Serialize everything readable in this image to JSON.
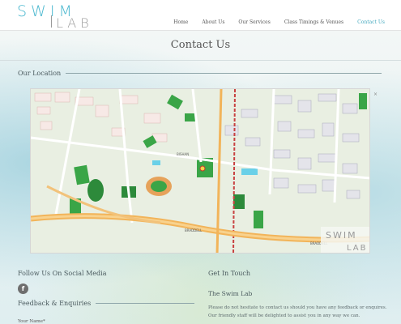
{
  "logo": {
    "line1": "SWIM",
    "line2": "LAB"
  },
  "nav": {
    "items": [
      {
        "label": "Home",
        "active": false
      },
      {
        "label": "About Us",
        "active": false
      },
      {
        "label": "Our Services",
        "active": false
      },
      {
        "label": "Class Timings & Venues",
        "active": false
      },
      {
        "label": "Contact Us",
        "active": true
      }
    ]
  },
  "page": {
    "title": "Contact Us"
  },
  "location": {
    "heading": "Our Location"
  },
  "map": {
    "watermark_line1": "SWIM",
    "watermark_line2": "LAB",
    "road_labels": [
      "BISHAN",
      "BRADDELL",
      "BRADDELL"
    ],
    "close_symbol": "×"
  },
  "social": {
    "heading": "Follow Us On Social Media",
    "facebook_glyph": "f"
  },
  "feedback": {
    "heading": "Feedback & Enquiries",
    "name_label": "Your Name*"
  },
  "contact": {
    "heading": "Get In Touch",
    "org_name": "The Swim Lab",
    "paragraph_line1": "Please do not hesitate to contact us should you have any feedback or enquires.",
    "paragraph_line2": "Our friendly staff will be delighted to assist you in any way we can."
  },
  "colors": {
    "accent": "#45a9bf",
    "nav_text": "#555555",
    "park_green": "#2f9e3b",
    "road_orange": "#f2b45a"
  }
}
